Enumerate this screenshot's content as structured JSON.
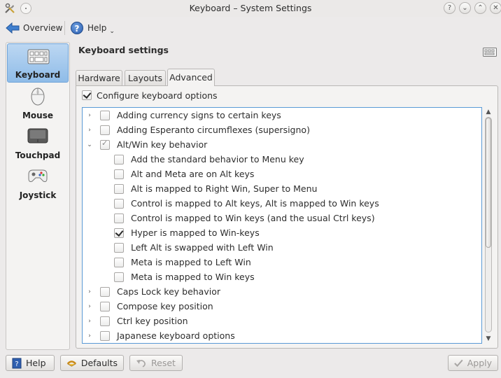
{
  "window": {
    "title": "Keyboard – System Settings",
    "controls": [
      "minimize",
      "maximize",
      "close"
    ]
  },
  "toolbar": {
    "overview_label": "Overview",
    "help_label": "Help"
  },
  "sidebar": {
    "items": [
      {
        "label": "Keyboard",
        "icon": "keyboard-icon",
        "selected": true
      },
      {
        "label": "Mouse",
        "icon": "mouse-icon",
        "selected": false
      },
      {
        "label": "Touchpad",
        "icon": "touchpad-icon",
        "selected": false
      },
      {
        "label": "Joystick",
        "icon": "joystick-icon",
        "selected": false
      }
    ]
  },
  "main": {
    "title": "Keyboard settings",
    "tabs": [
      {
        "label": "Hardware",
        "active": false
      },
      {
        "label": "Layouts",
        "active": false
      },
      {
        "label": "Advanced",
        "active": true
      }
    ],
    "configure_label": "Configure keyboard options",
    "configure_checked": true
  },
  "tree": {
    "rows": [
      {
        "label": "Adding currency signs to certain keys",
        "level": 0,
        "expander": "collapsed",
        "state": "unchecked"
      },
      {
        "label": "Adding Esperanto circumflexes (supersigno)",
        "level": 0,
        "expander": "collapsed",
        "state": "unchecked"
      },
      {
        "label": "Alt/Win key behavior",
        "level": 0,
        "expander": "expanded",
        "state": "partial"
      },
      {
        "label": "Add the standard behavior to Menu key",
        "level": 1,
        "expander": "none",
        "state": "unchecked"
      },
      {
        "label": "Alt and Meta are on Alt keys",
        "level": 1,
        "expander": "none",
        "state": "unchecked"
      },
      {
        "label": "Alt is mapped to Right Win, Super to Menu",
        "level": 1,
        "expander": "none",
        "state": "unchecked"
      },
      {
        "label": "Control is mapped to Alt keys, Alt is mapped to Win keys",
        "level": 1,
        "expander": "none",
        "state": "unchecked"
      },
      {
        "label": "Control is mapped to Win keys (and the usual Ctrl keys)",
        "level": 1,
        "expander": "none",
        "state": "unchecked"
      },
      {
        "label": "Hyper is mapped to Win-keys",
        "level": 1,
        "expander": "none",
        "state": "checked"
      },
      {
        "label": "Left Alt is swapped with Left Win",
        "level": 1,
        "expander": "none",
        "state": "unchecked"
      },
      {
        "label": "Meta is mapped to Left Win",
        "level": 1,
        "expander": "none",
        "state": "unchecked"
      },
      {
        "label": "Meta is mapped to Win keys",
        "level": 1,
        "expander": "none",
        "state": "unchecked"
      },
      {
        "label": "Caps Lock key behavior",
        "level": 0,
        "expander": "collapsed",
        "state": "unchecked"
      },
      {
        "label": "Compose key position",
        "level": 0,
        "expander": "collapsed",
        "state": "unchecked"
      },
      {
        "label": "Ctrl key position",
        "level": 0,
        "expander": "collapsed",
        "state": "unchecked"
      },
      {
        "label": "Japanese keyboard options",
        "level": 0,
        "expander": "collapsed",
        "state": "unchecked"
      }
    ]
  },
  "buttons": {
    "help": "Help",
    "defaults": "Defaults",
    "reset": "Reset",
    "apply": "Apply"
  }
}
